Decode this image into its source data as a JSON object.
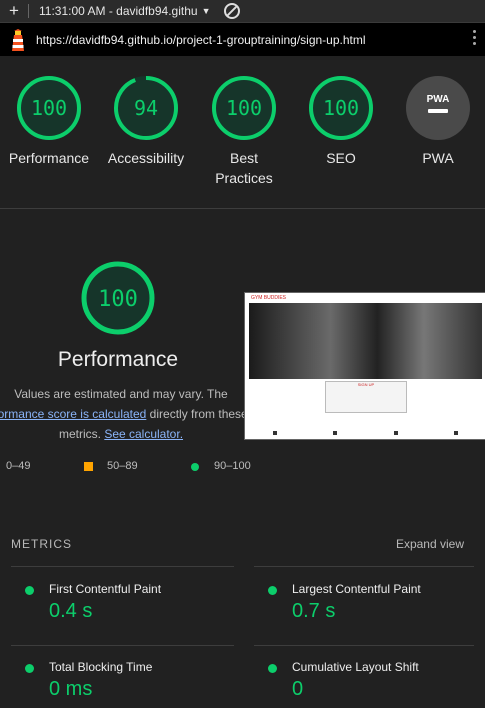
{
  "browser": {
    "time_tab": "11:31:00 AM - davidfb94.githu",
    "url": "https://davidfb94.github.io/project-1-grouptraining/sign-up.html"
  },
  "colors": {
    "pass": "#0cce6b",
    "average": "#ffa400",
    "background": "#212121"
  },
  "gauges": [
    {
      "label": "Performance",
      "score": "100",
      "value": 100
    },
    {
      "label": "Accessibility",
      "score": "94",
      "value": 94
    },
    {
      "label_line1": "Best",
      "label_line2": "Practices",
      "score": "100",
      "value": 100
    },
    {
      "label": "SEO",
      "score": "100",
      "value": 100
    },
    {
      "label": "PWA",
      "badge_text": "PWA"
    }
  ],
  "performance": {
    "score": "100",
    "title": "Performance",
    "desc_part1": "Values are estimated and may vary. The",
    "desc_link1": "formance score is calculated",
    "desc_part2": " directly from these",
    "desc_part3": "metrics. ",
    "desc_link2": "See calculator."
  },
  "thumbnail": {
    "brand": "GYM BUDDIES",
    "form_title": "SIGN UP"
  },
  "legend": {
    "fail": "0–49",
    "average": "50–89",
    "pass": "90–100"
  },
  "metrics": {
    "heading": "METRICS",
    "expand_label": "Expand view",
    "items": [
      {
        "name": "First Contentful Paint",
        "value": "0.4 s"
      },
      {
        "name": "Largest Contentful Paint",
        "value": "0.7 s"
      },
      {
        "name": "Total Blocking Time",
        "value": "0 ms"
      },
      {
        "name": "Cumulative Layout Shift",
        "value": "0"
      }
    ]
  }
}
